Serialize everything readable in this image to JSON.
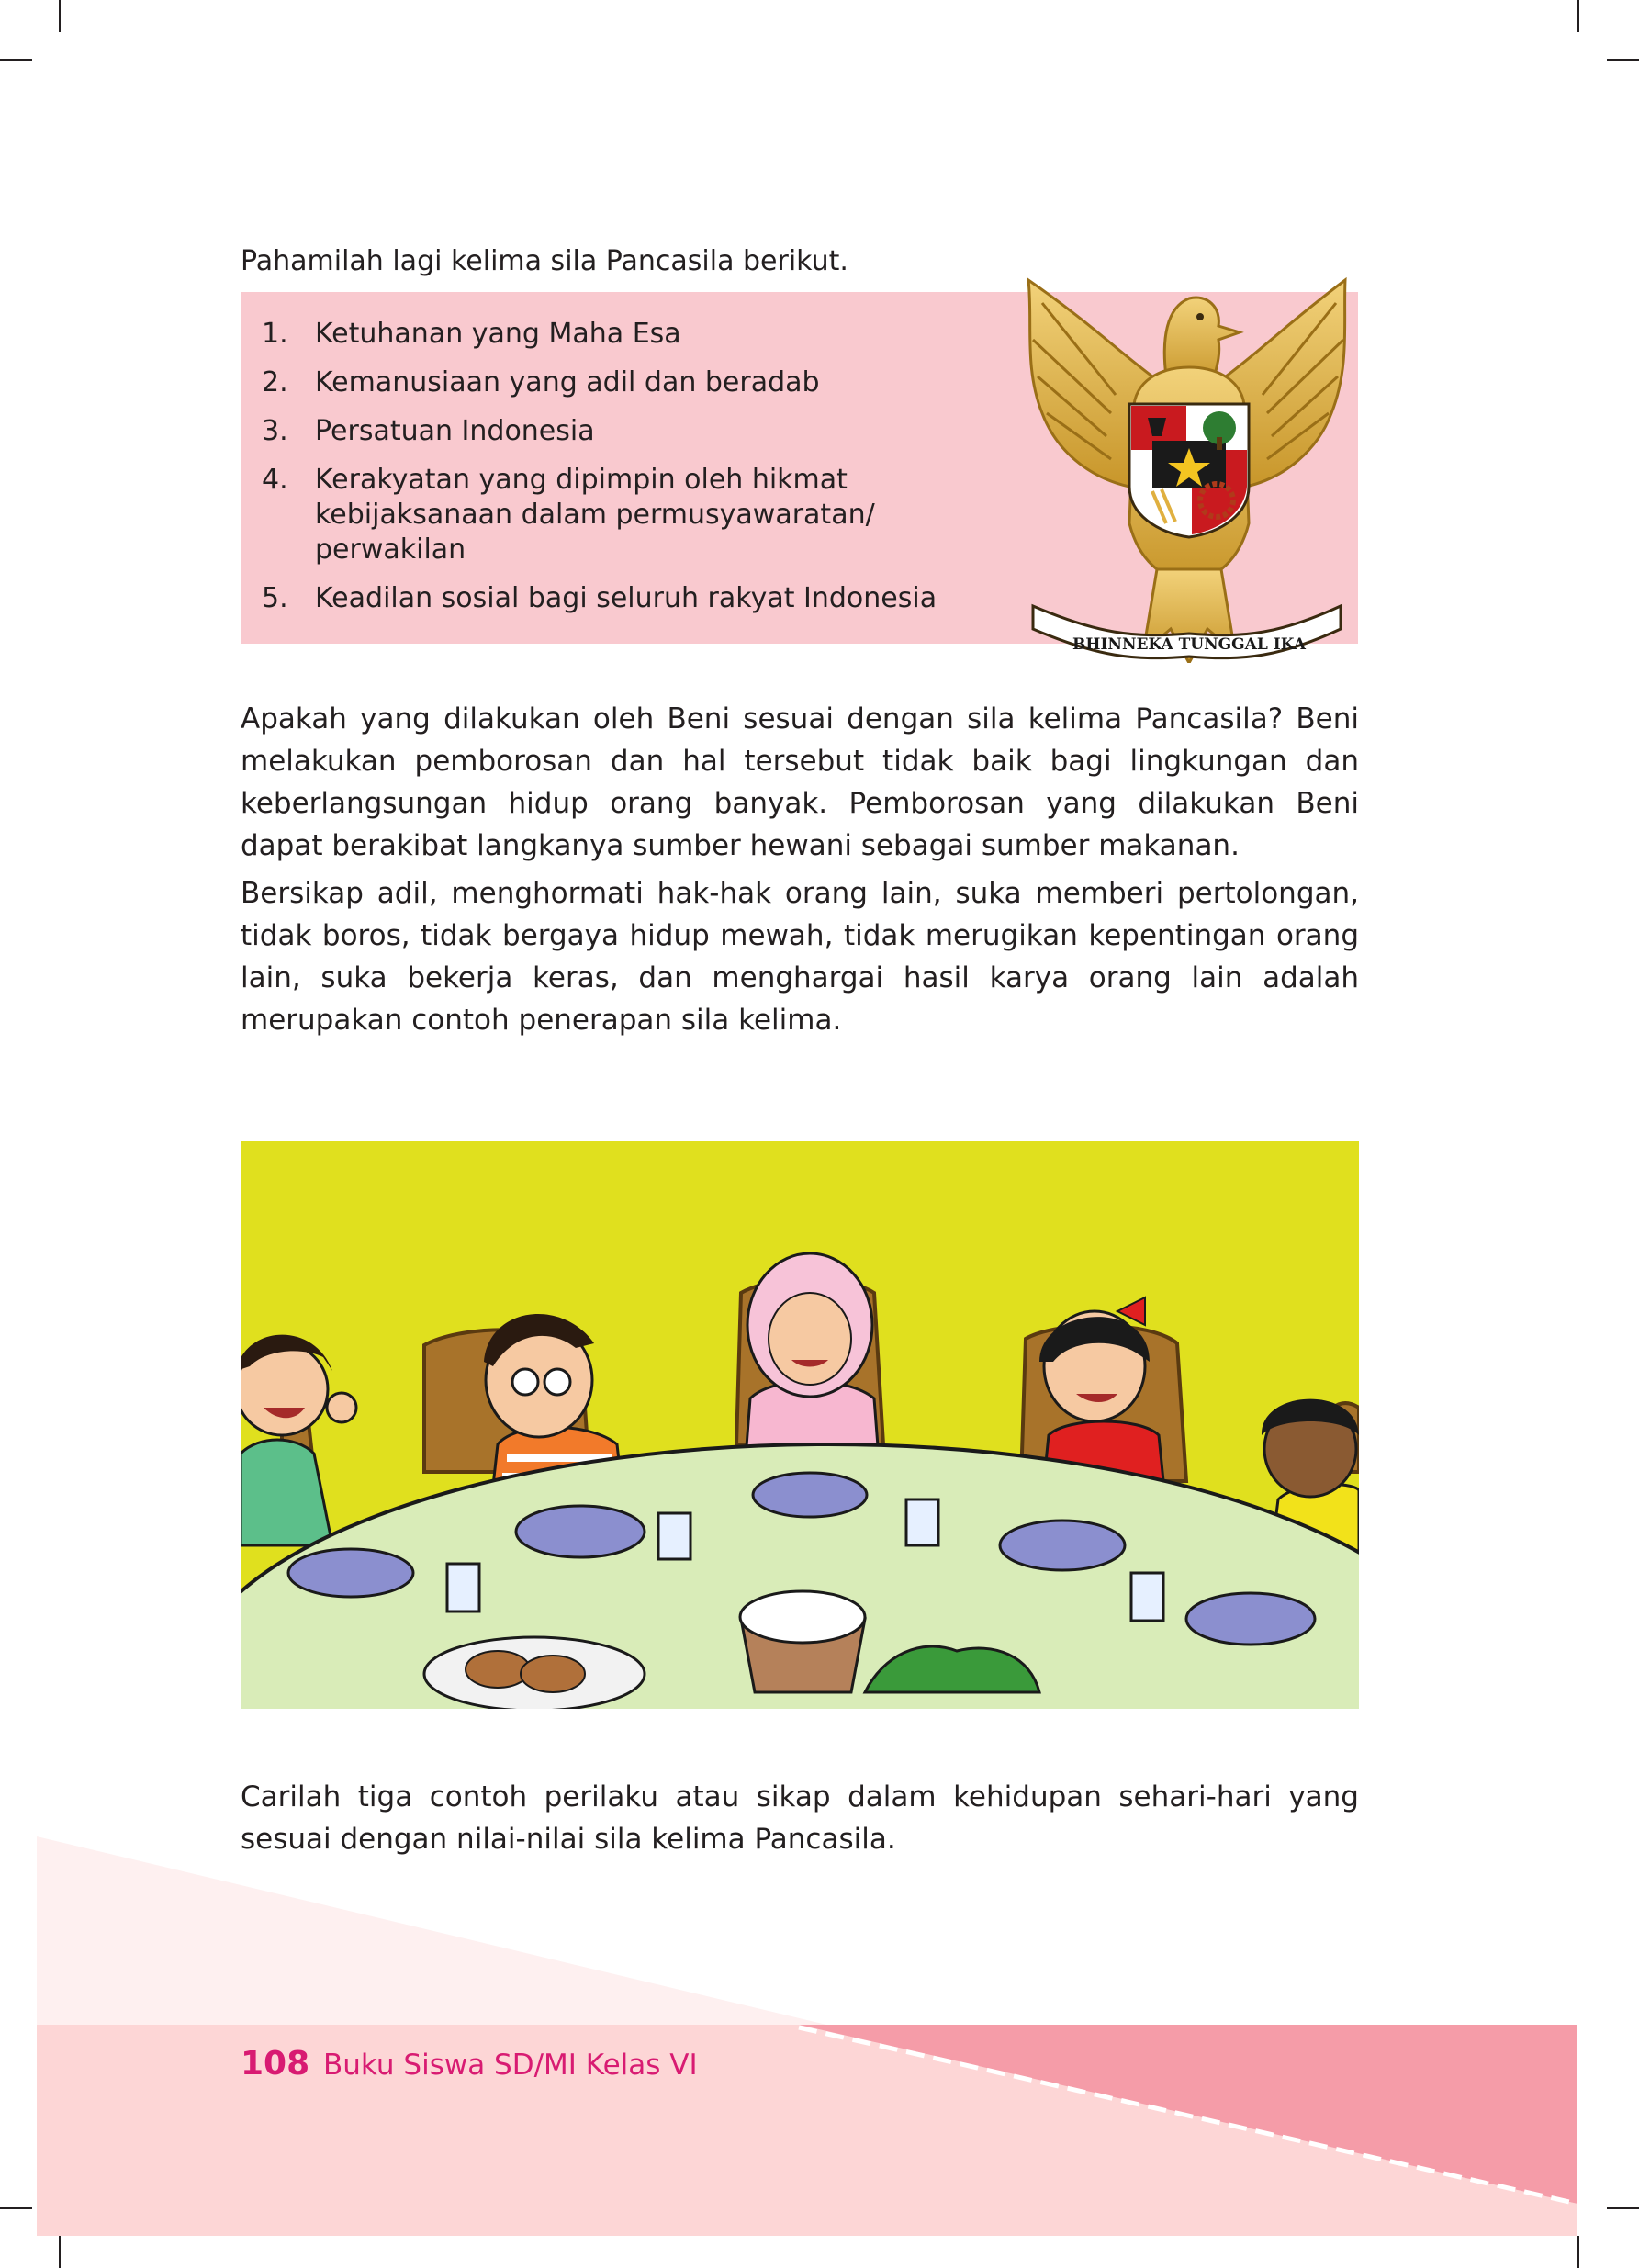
{
  "intro": "Pahamilah lagi kelima sila Pancasila berikut.",
  "sila": [
    {
      "num": "1.",
      "text": "Ketuhanan yang Maha Esa"
    },
    {
      "num": "2.",
      "text": "Kemanusiaan yang adil dan beradab"
    },
    {
      "num": "3.",
      "text": "Persatuan Indonesia"
    },
    {
      "num": "4.",
      "text": "Kerakyatan yang dipimpin oleh hikmat kebijaksanaan dalam permusyawaratan/ perwakilan"
    },
    {
      "num": "5.",
      "text": "Keadilan sosial bagi seluruh rakyat Indonesia"
    }
  ],
  "emblem_motto": "BHINNEKA TUNGGAL IKA",
  "paragraph1": "Apakah yang dilakukan oleh Beni sesuai dengan sila kelima Pancasila?  Beni melakukan pemborosan dan hal tersebut tidak baik bagi lingkungan dan keberlangsungan hidup orang banyak. Pemborosan yang dilakukan Beni dapat berakibat langkanya sumber hewani sebagai sumber makanan.",
  "paragraph2": "Bersikap adil, menghormati hak-hak orang lain, suka memberi pertolongan, tidak boros, tidak bergaya hidup mewah, tidak merugikan kepentingan orang lain, suka bekerja keras, dan menghargai hasil karya orang lain adalah merupakan contoh penerapan sila kelima.",
  "paragraph3": "Carilah tiga contoh perilaku atau sikap dalam kehidupan sehari-hari yang sesuai dengan nilai-nilai sila kelima Pancasila.",
  "footer": {
    "page_number": "108",
    "book_title": "Buku Siswa SD/MI Kelas VI"
  },
  "colors": {
    "sila_box": "#f9c9cf",
    "illustration_bg": "#e0e01e",
    "footer_pink": "#f59ca8",
    "footer_light": "#fde3e3",
    "accent_text": "#d81b72"
  }
}
